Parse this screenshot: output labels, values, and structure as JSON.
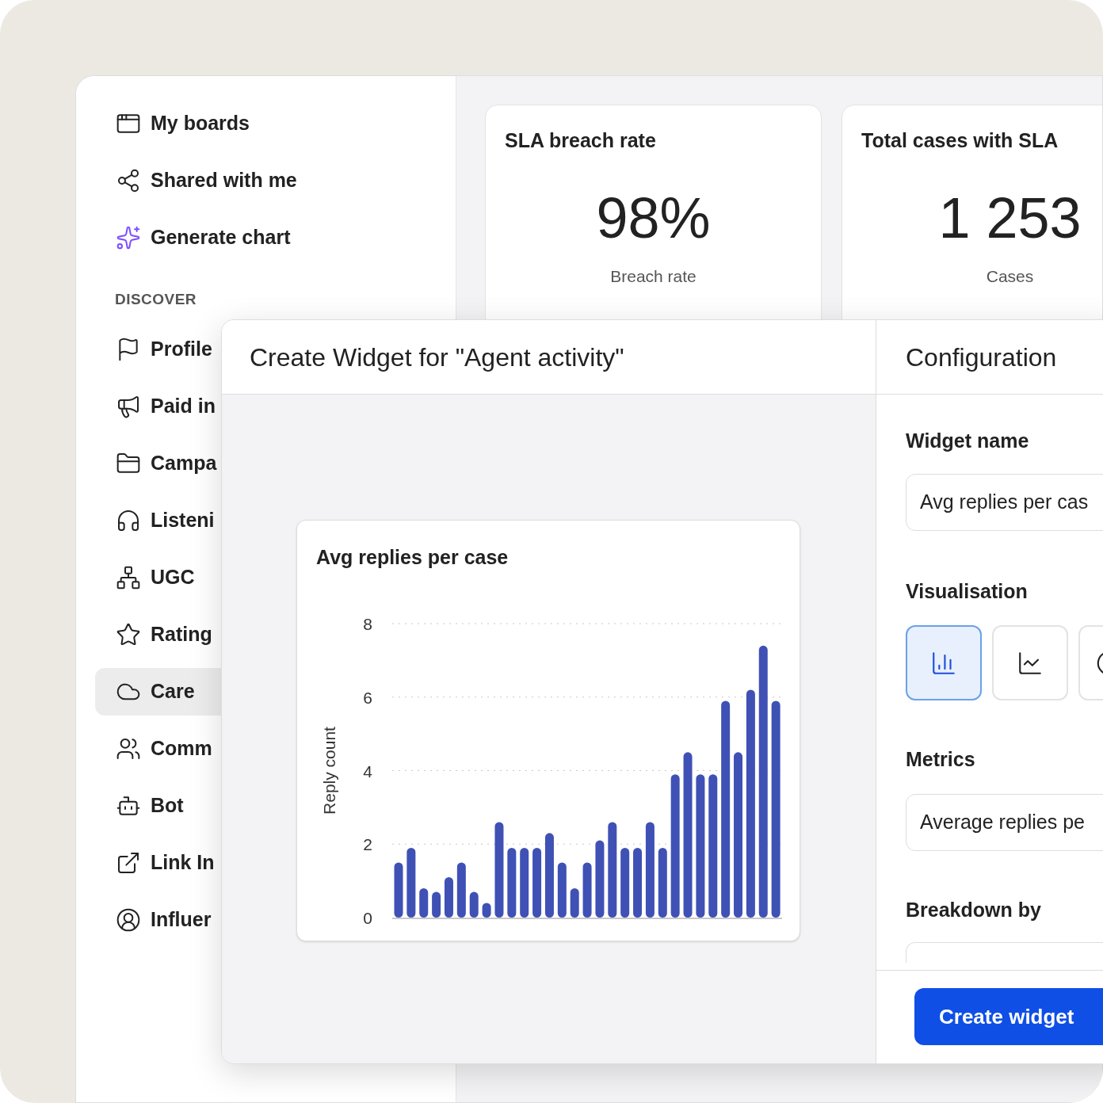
{
  "sidebar": {
    "items": [
      {
        "label": "My boards",
        "selected": false
      },
      {
        "label": "Shared with me",
        "selected": false
      },
      {
        "label": "Generate chart",
        "selected": false
      }
    ],
    "section_title": "DISCOVER",
    "discover_items": [
      {
        "label": "Profile",
        "selected": false
      },
      {
        "label": "Paid in",
        "selected": false
      },
      {
        "label": "Campa",
        "selected": false
      },
      {
        "label": "Listeni",
        "selected": false
      },
      {
        "label": "UGC",
        "selected": false
      },
      {
        "label": "Rating",
        "selected": false
      },
      {
        "label": "Care",
        "selected": true
      },
      {
        "label": "Comm",
        "selected": false
      },
      {
        "label": "Bot",
        "selected": false
      },
      {
        "label": "Link In",
        "selected": false
      },
      {
        "label": "Influer",
        "selected": false
      }
    ]
  },
  "cards": [
    {
      "title": "SLA breach rate",
      "value": "98%",
      "caption": "Breach rate"
    },
    {
      "title": "Total cases with SLA",
      "value": "1 253",
      "caption": "Cases"
    }
  ],
  "modal": {
    "title": "Create Widget for \"Agent activity\"",
    "preview": {
      "title": "Avg replies per case",
      "chart_data": {
        "type": "bar",
        "ylabel": "Reply count",
        "ylim": [
          0,
          8
        ],
        "yticks": [
          0,
          2,
          4,
          6,
          8
        ],
        "grid": true,
        "series": [
          {
            "color": "#3f51b5",
            "values": [
              1.5,
              1.9,
              0.8,
              0.7,
              1.1,
              1.5,
              0.7,
              0.4,
              2.6,
              1.9,
              1.9,
              1.9,
              2.3,
              1.5,
              0.8,
              1.5,
              2.1,
              2.6,
              1.9,
              1.9,
              2.6,
              1.9,
              3.9,
              4.5,
              3.9,
              3.9,
              5.9,
              4.5,
              6.2,
              7.4,
              5.9
            ]
          }
        ]
      }
    }
  },
  "configuration": {
    "title": "Configuration",
    "widget_name": {
      "label": "Widget name",
      "value": "Avg replies per cas"
    },
    "visualisation": {
      "label": "Visualisation",
      "options": [
        {
          "kind": "bar",
          "selected": true
        },
        {
          "kind": "line",
          "selected": false
        },
        {
          "kind": "pie",
          "selected": false
        }
      ]
    },
    "metrics": {
      "label": "Metrics",
      "value": "Average replies pe"
    },
    "breakdown": {
      "label": "Breakdown by"
    },
    "button": "Create widget"
  }
}
